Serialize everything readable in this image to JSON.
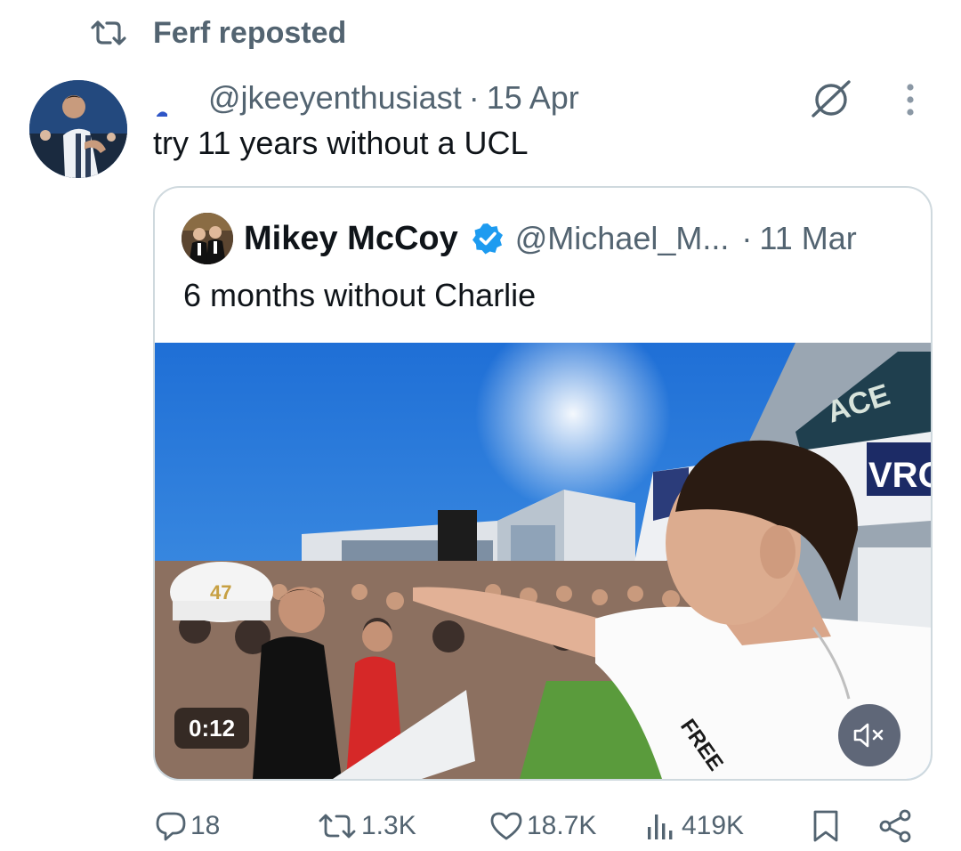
{
  "repost": {
    "label": "Ferf reposted",
    "icon": "repost-icon"
  },
  "post": {
    "handle": "@jkeeyenthusiast",
    "separator": "·",
    "date": "15 Apr",
    "text": "try 11 years without a UCL"
  },
  "quote": {
    "name": "Mikey McCoy",
    "verified": true,
    "handle": "@Michael_M...",
    "separator": "·",
    "date": "11 Mar",
    "text": "6 months without Charlie",
    "video": {
      "duration": "0:12",
      "muted": true,
      "cap_text": "47",
      "sign_text": "ACE",
      "banner_text": "VRO",
      "shirt_text": "FREE"
    }
  },
  "actions": {
    "replies": "18",
    "reposts": "1.3K",
    "likes": "18.7K",
    "views": "419K"
  },
  "colors": {
    "text": "#0f1419",
    "muted": "#536471",
    "border": "#cfd9de",
    "verified": "#1d9bf0"
  }
}
